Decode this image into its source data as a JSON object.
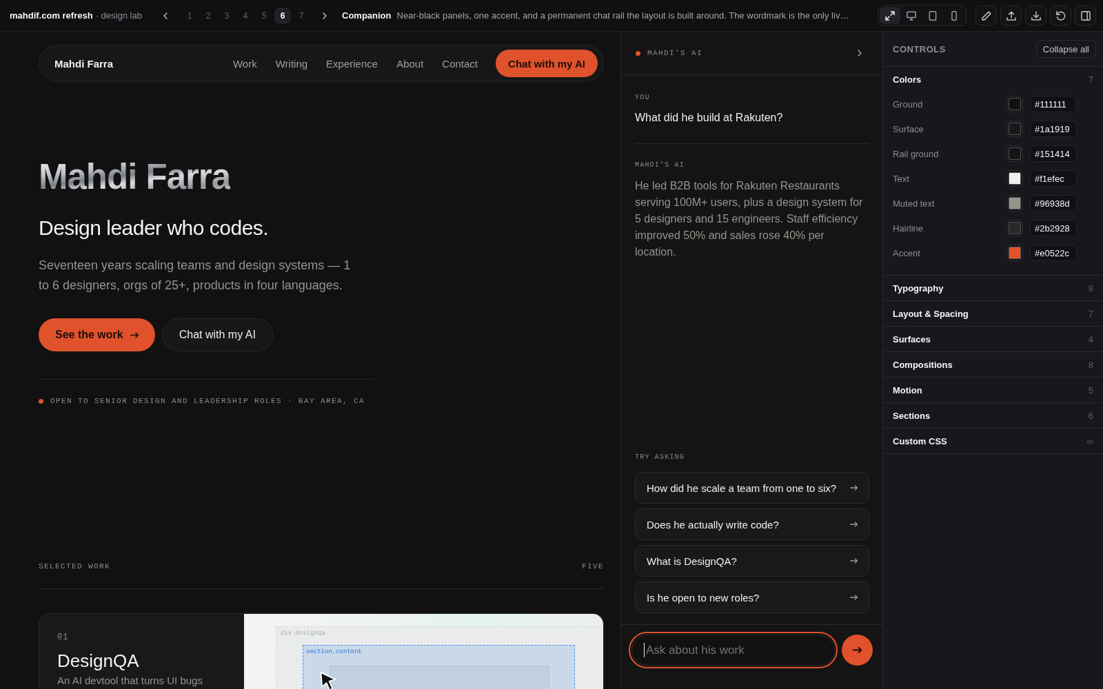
{
  "topbar": {
    "project": "mahdif.com refresh",
    "subtitle": "· design lab",
    "pages": [
      {
        "label": "1",
        "selected": false
      },
      {
        "label": "2",
        "selected": false
      },
      {
        "label": "3",
        "selected": false
      },
      {
        "label": "4",
        "selected": false
      },
      {
        "label": "5",
        "selected": false
      },
      {
        "label": "6",
        "selected": true
      },
      {
        "label": "7",
        "selected": false
      }
    ],
    "variant": {
      "name": "Companion",
      "description": "Near-black panels, one accent, and a permanent chat rail the layout is built around. The wordmark is the only liv…"
    },
    "view_modes": [
      {
        "selected": true
      },
      {
        "selected": false
      },
      {
        "selected": false
      },
      {
        "selected": false
      }
    ]
  },
  "site": {
    "nav": {
      "brand": "Mahdi Farra",
      "links": [
        "Work",
        "Writing",
        "Experience",
        "About",
        "Contact"
      ],
      "cta": "Chat with my AI"
    },
    "hero": {
      "name": "Mahdi Farra",
      "headline": "Design leader who codes.",
      "intro": "Seventeen years scaling teams and design systems — 1 to 6 designers, orgs of 25+, products in four languages.",
      "buttons": [
        {
          "label": "See the work",
          "kind": "primary"
        },
        {
          "label": "Chat with my AI",
          "kind": "secondary"
        }
      ],
      "status": "OPEN TO SENIOR DESIGN AND LEADERSHIP ROLES · BAY AREA, CA"
    },
    "work": {
      "heading": "SELECTED WORK",
      "count": "FIVE",
      "projects": [
        {
          "number": "01",
          "title": "DesignQA",
          "summary": "An AI devtool that turns UI bugs",
          "preview": {
            "frame_label": "div.designqa",
            "selection_label": "section.content"
          }
        }
      ]
    }
  },
  "chat": {
    "title": "MAHDI'S AI",
    "messages": [
      {
        "kind": "user",
        "author": "YOU",
        "text": "What did he build at Rakuten?"
      },
      {
        "kind": "assistant",
        "author": "MAHDI'S AI",
        "text": "He led B2B tools for Rakuten Restaurants serving 100M+ users, plus a design system for 5 designers and 15 engineers. Staff efficiency improved 50% and sales rose 40% per location."
      }
    ],
    "suggestions_label": "TRY ASKING",
    "suggestions": [
      "How did he scale a team from one to six?",
      "Does he actually write code?",
      "What is DesignQA?",
      "Is he open to new roles?"
    ],
    "input": {
      "placeholder": "Ask about his work",
      "focused": true
    }
  },
  "controls": {
    "title": "CONTROLS",
    "collapse_button": "Collapse all",
    "sections": [
      {
        "name": "Colors",
        "count": "7",
        "fields": [
          {
            "label": "Ground",
            "value": "#111111",
            "color": "#111111"
          },
          {
            "label": "Surface",
            "value": "#1a1919",
            "color": "#1a1919"
          },
          {
            "label": "Rail ground",
            "value": "#151414",
            "color": "#151414"
          },
          {
            "label": "Text",
            "value": "#f1efec",
            "color": "#f1efec"
          },
          {
            "label": "Muted text",
            "value": "#96938d",
            "color": "#96938d"
          },
          {
            "label": "Hairline",
            "value": "#2b2928",
            "color": "#2b2928"
          },
          {
            "label": "Accent",
            "value": "#e0522c",
            "color": "#e0522c"
          }
        ]
      },
      {
        "name": "Typography",
        "count": "8"
      },
      {
        "name": "Layout & Spacing",
        "count": "7"
      },
      {
        "name": "Surfaces",
        "count": "4"
      },
      {
        "name": "Compositions",
        "count": "8"
      },
      {
        "name": "Motion",
        "count": "5"
      },
      {
        "name": "Sections",
        "count": "6"
      },
      {
        "name": "Custom CSS",
        "count": "∞"
      }
    ]
  }
}
